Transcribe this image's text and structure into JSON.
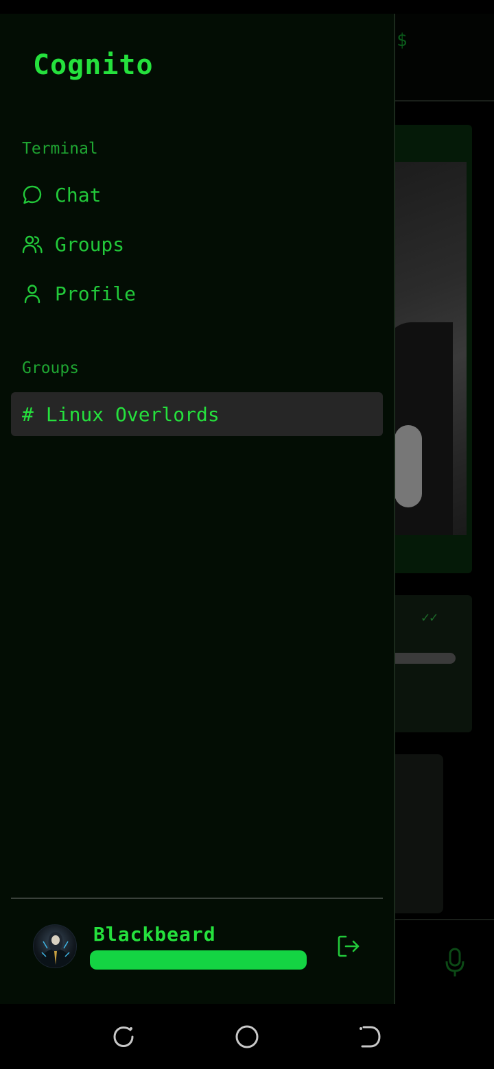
{
  "app": {
    "title": "Cognito"
  },
  "sidebar": {
    "terminal_section_label": "Terminal",
    "nav_items": [
      {
        "label": "Chat",
        "icon": "chat-bubble-icon"
      },
      {
        "label": "Groups",
        "icon": "users-icon"
      },
      {
        "label": "Profile",
        "icon": "user-icon"
      }
    ],
    "groups_section_label": "Groups",
    "groups": [
      {
        "prefix": "#",
        "name": "Linux Overlords",
        "selected": true
      }
    ]
  },
  "user": {
    "name": "Blackbeard",
    "avatar": "hooded-figure-avatar",
    "status_bar_color": "#14d443",
    "logout_icon": "logout-icon"
  },
  "background": {
    "prompt_symbol": "$"
  },
  "system_nav": {
    "buttons": [
      "recents-icon",
      "home-icon",
      "back-icon"
    ]
  },
  "colors": {
    "accent": "#25e13d",
    "drawer_bg": "#030d04",
    "selected_row_bg": "#262626"
  }
}
